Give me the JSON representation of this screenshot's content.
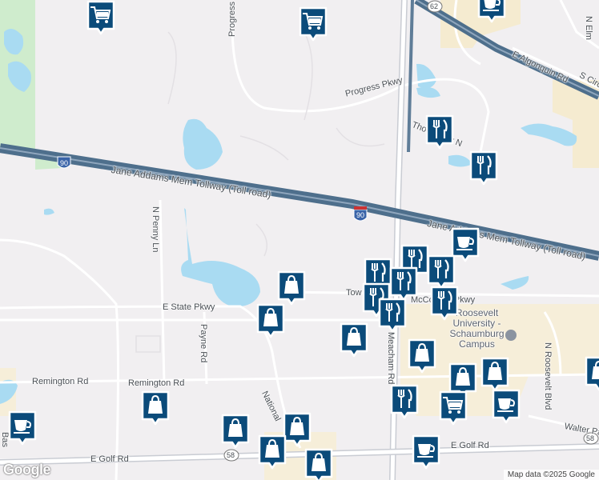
{
  "map": {
    "logo": "Google",
    "attribution": "Map data ©2025 Google"
  },
  "roads": {
    "tollway": "Jane Addams Mem Tollway (Toll road)",
    "tollway_east": "Jane Addams Mem Tollway (Toll road)",
    "progress_pkwy": "Progress Pkwy",
    "progress": "Progress",
    "e_algonquin": "E Algonquin Rd",
    "e_state": "E State Pkwy",
    "remington_w": "Remington Rd",
    "remington_e": "Remington Rd",
    "e_golf_w": "E Golf Rd",
    "e_golf_e": "E Golf Rd",
    "n_penny": "N Penny Ln",
    "payne": "Payne Rd",
    "n_roosevelt": "N Roosevelt Blvd",
    "national": "National",
    "walter": "Walter Pa",
    "meacham": "Meacham Rd",
    "tower": "Tow",
    "mcconnor": "McConnor Pkwy",
    "thoreau": "Thoreau Dr N",
    "n_elm": "N Elm",
    "s_circle": "S Circ",
    "bas": "Bas",
    "roosevelt_univ": "Roosevelt University - Schaumburg Campus"
  },
  "shields": {
    "i90_west": "90",
    "i90_east": "90",
    "r62": "62",
    "r58_w": "58",
    "r58_e": "58"
  },
  "markers": [
    {
      "kind": "grocery",
      "icon": "shopping-cart-icon"
    },
    {
      "kind": "grocery",
      "icon": "shopping-cart-icon"
    },
    {
      "kind": "cafe",
      "icon": "coffee-cup-icon"
    },
    {
      "kind": "restaurant",
      "icon": "fork-knife-icon"
    },
    {
      "kind": "restaurant",
      "icon": "fork-knife-icon"
    },
    {
      "kind": "cafe",
      "icon": "coffee-cup-icon"
    },
    {
      "kind": "restaurant",
      "icon": "fork-knife-icon"
    },
    {
      "kind": "restaurant",
      "icon": "fork-knife-icon"
    },
    {
      "kind": "restaurant",
      "icon": "fork-knife-icon"
    },
    {
      "kind": "restaurant",
      "icon": "fork-knife-icon"
    },
    {
      "kind": "restaurant",
      "icon": "fork-knife-icon"
    },
    {
      "kind": "restaurant",
      "icon": "fork-knife-icon"
    },
    {
      "kind": "restaurant",
      "icon": "fork-knife-icon"
    },
    {
      "kind": "shopping",
      "icon": "shopping-bag-icon"
    },
    {
      "kind": "shopping",
      "icon": "shopping-bag-icon"
    },
    {
      "kind": "shopping",
      "icon": "shopping-bag-icon"
    },
    {
      "kind": "shopping",
      "icon": "shopping-bag-icon"
    },
    {
      "kind": "shopping",
      "icon": "shopping-bag-icon"
    },
    {
      "kind": "shopping",
      "icon": "shopping-bag-icon"
    },
    {
      "kind": "shopping",
      "icon": "shopping-bag-icon"
    },
    {
      "kind": "restaurant",
      "icon": "fork-knife-icon"
    },
    {
      "kind": "grocery",
      "icon": "shopping-cart-icon"
    },
    {
      "kind": "cafe",
      "icon": "coffee-cup-icon"
    },
    {
      "kind": "shopping",
      "icon": "shopping-bag-icon"
    },
    {
      "kind": "shopping",
      "icon": "shopping-bag-icon"
    },
    {
      "kind": "shopping",
      "icon": "shopping-bag-icon"
    },
    {
      "kind": "shopping",
      "icon": "shopping-bag-icon"
    },
    {
      "kind": "cafe",
      "icon": "coffee-cup-icon"
    },
    {
      "kind": "cafe",
      "icon": "coffee-cup-icon"
    },
    {
      "kind": "shopping",
      "icon": "shopping-bag-icon"
    }
  ],
  "colors": {
    "marker_fill": "#0b4b7a",
    "marker_border": "#ffffff",
    "background": "#f1eff1",
    "water": "#a9dbf2",
    "park": "#cfeccd",
    "commercial": "#f5ebd0",
    "highway": "#4e6f8c"
  }
}
